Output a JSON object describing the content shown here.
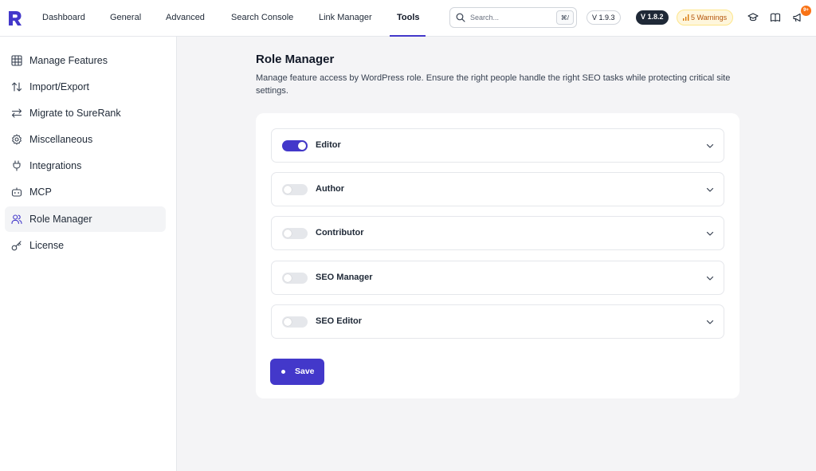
{
  "nav": {
    "items": [
      {
        "label": "Dashboard"
      },
      {
        "label": "General"
      },
      {
        "label": "Advanced"
      },
      {
        "label": "Search Console"
      },
      {
        "label": "Link Manager"
      },
      {
        "label": "Tools"
      }
    ],
    "active": "Tools"
  },
  "search": {
    "placeholder": "Search...",
    "shortcut": "⌘/"
  },
  "badges": {
    "version_free": "V 1.9.3",
    "version_pro": "V 1.8.2",
    "warnings": "5 Warnings",
    "notifications": "9+"
  },
  "icons": {
    "logo": "surerank-logo-icon",
    "search": "search-icon",
    "warnings": "signal-bars-icon",
    "academy": "graduation-cap-icon",
    "docs": "open-book-icon",
    "announcements": "megaphone-icon"
  },
  "sidebar": {
    "items": [
      {
        "label": "Manage Features",
        "icon": "grid-table-icon"
      },
      {
        "label": "Import/Export",
        "icon": "arrows-up-down-icon"
      },
      {
        "label": "Migrate to SureRank",
        "icon": "arrows-left-right-icon"
      },
      {
        "label": "Miscellaneous",
        "icon": "gear-icon"
      },
      {
        "label": "Integrations",
        "icon": "plug-icon"
      },
      {
        "label": "MCP",
        "icon": "robot-icon"
      },
      {
        "label": "Role Manager",
        "icon": "users-icon"
      },
      {
        "label": "License",
        "icon": "key-icon"
      }
    ],
    "active": "Role Manager"
  },
  "main": {
    "title": "Role Manager",
    "description": "Manage feature access by WordPress role. Ensure the right people handle the right SEO tasks while protecting critical site settings.",
    "roles": [
      {
        "label": "Editor",
        "enabled": true
      },
      {
        "label": "Author",
        "enabled": false
      },
      {
        "label": "Contributor",
        "enabled": false
      },
      {
        "label": "SEO Manager",
        "enabled": false
      },
      {
        "label": "SEO Editor",
        "enabled": false
      }
    ],
    "save_label": "Save"
  },
  "colors": {
    "accent": "#4338ca",
    "warning_bg": "#fef6dc",
    "warning_text": "#b45309",
    "notification": "#f97316"
  }
}
